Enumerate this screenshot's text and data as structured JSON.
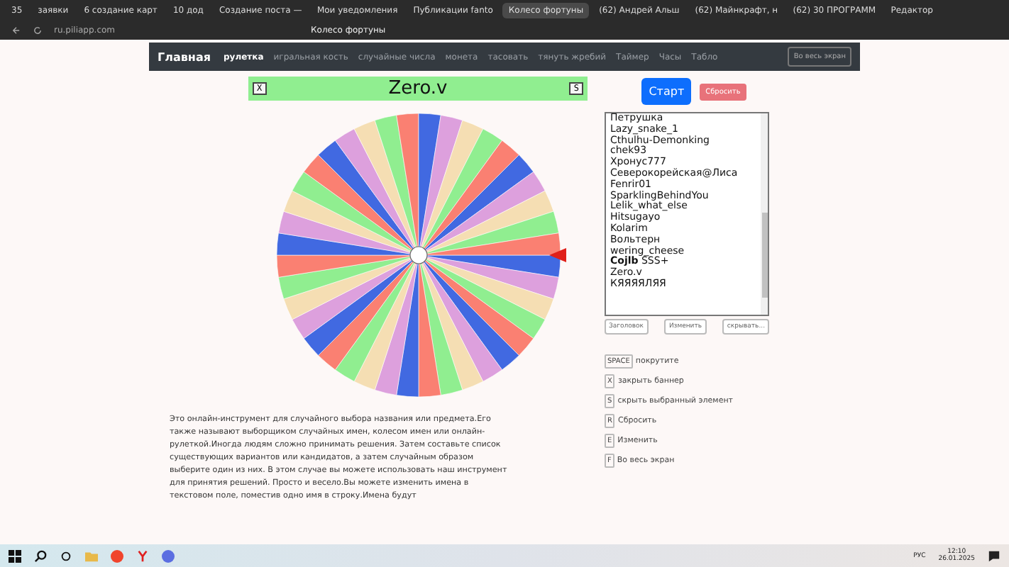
{
  "browser": {
    "tabs": [
      {
        "label": "35",
        "selected": false
      },
      {
        "label": "заявки",
        "selected": false
      },
      {
        "label": "6 создание карт",
        "selected": false
      },
      {
        "label": "10 дод",
        "selected": false
      },
      {
        "label": "Создание поста —",
        "selected": false
      },
      {
        "label": "Мои уведомления",
        "selected": false
      },
      {
        "label": "Публикации fanto",
        "selected": false
      },
      {
        "label": "Колесо фортуны",
        "selected": true
      },
      {
        "label": "(62) Андрей Альш",
        "selected": false
      },
      {
        "label": "(62) Майнкрафт, н",
        "selected": false
      },
      {
        "label": "(62) 30 ПРОГРАММ",
        "selected": false
      },
      {
        "label": "Редактор",
        "selected": false
      }
    ],
    "address": "ru.piliapp.com",
    "page_title": "Колесо фортуны"
  },
  "nav": {
    "brand": "Главная",
    "items": [
      {
        "label": "рулетка",
        "selected": true
      },
      {
        "label": "игральная кость",
        "selected": false
      },
      {
        "label": "случайные числа",
        "selected": false
      },
      {
        "label": "монета",
        "selected": false
      },
      {
        "label": "тасовать",
        "selected": false
      },
      {
        "label": "тянуть жребий",
        "selected": false
      },
      {
        "label": "Таймер",
        "selected": false
      },
      {
        "label": "Часы",
        "selected": false
      },
      {
        "label": "Табло",
        "selected": false
      }
    ],
    "fullscreen": "Во весь экран"
  },
  "banner": {
    "close_key": "X",
    "title": "Zero.v",
    "hide_key": "S"
  },
  "controls": {
    "start": "Старт",
    "reset": "Сбросить"
  },
  "names": [
    "Петрушка",
    "Lazy_snake_1",
    "Cthulhu-Demonking",
    "chek93",
    "Хронус777",
    "Северокорейская@Лиса",
    "Fenrir01",
    "SparklingBehindYou",
    "Lelik_what_else",
    "Hitsugayo",
    "Kolarim",
    "Вольтерн",
    "wering_cheese",
    "**Cojlb**   SSS+",
    "Zero.v",
    "КЯЯЯЯЛЯЯ"
  ],
  "list_buttons": [
    "Заголовок",
    "Изменить",
    "скрывать..."
  ],
  "shortcuts": [
    {
      "key": "SPACE",
      "action": "покрутите"
    },
    {
      "key": "X",
      "action": "закрыть баннер"
    },
    {
      "key": "S",
      "action": "скрыть выбранный элемент"
    },
    {
      "key": "R",
      "action": "Сбросить"
    },
    {
      "key": "E",
      "action": "Изменить"
    },
    {
      "key": "F",
      "action": "Во весь экран"
    }
  ],
  "description": "Это онлайн-инструмент для случайного выбора названия или предмета.Его также называют выборщиком случайных имен, колесом имен или онлайн-рулеткой.Иногда людям сложно принимать решения. Затем составьте список существующих вариантов или кандидатов, а затем случайным образом выберите один из них. В этом случае вы можете использовать наш инструмент для принятия решений. Просто и весело.Вы можете изменить имена в текстовом поле, поместив одно имя в строку.Имена будут",
  "taskbar": {
    "language": "РУС",
    "time": "12:10",
    "date": "26.01.2025"
  }
}
